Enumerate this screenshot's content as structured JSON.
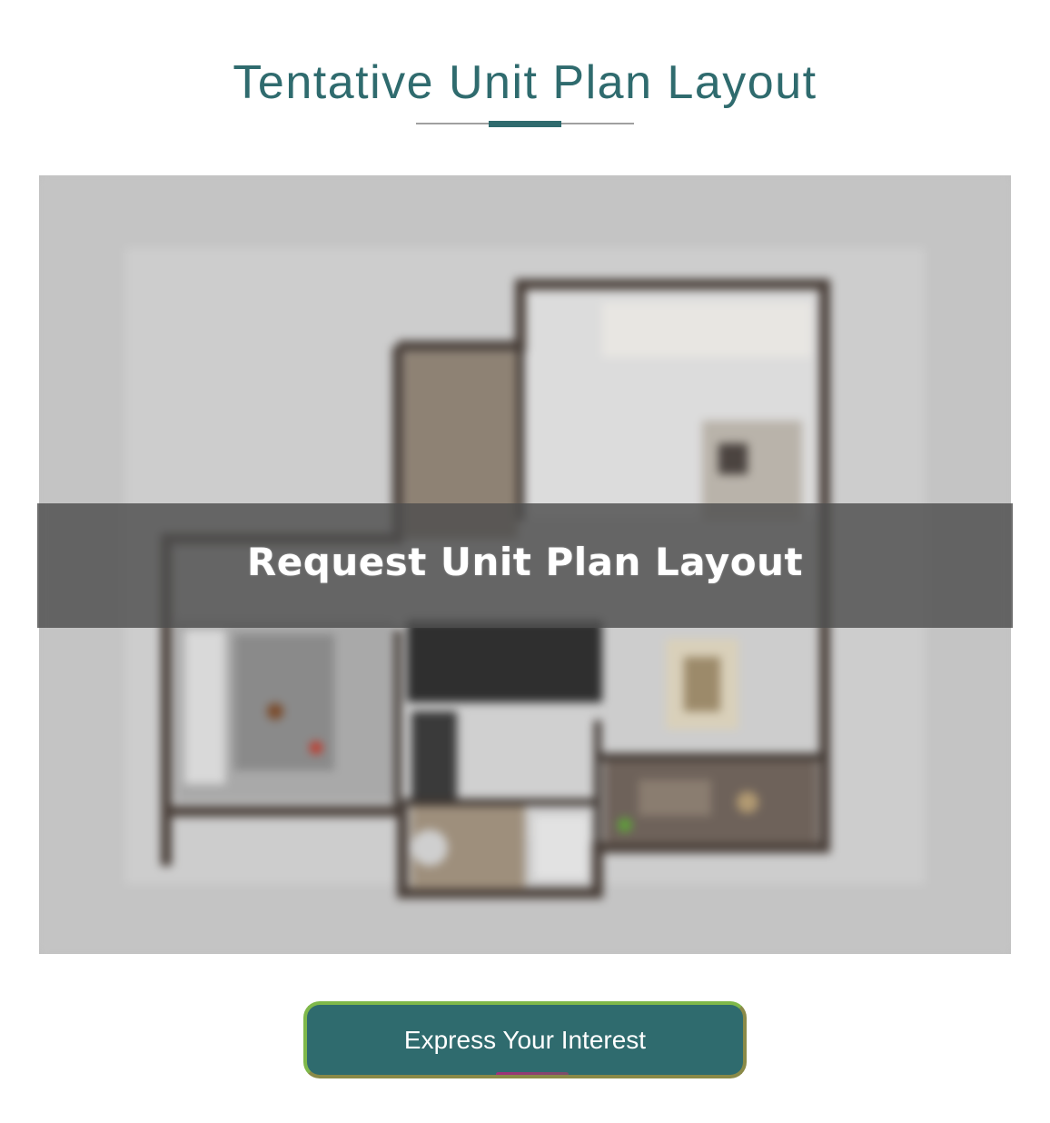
{
  "section": {
    "title": "Tentative Unit Plan Layout"
  },
  "plan": {
    "overlay_label": "Request Unit Plan Layout",
    "image_description_icon": "floor-plan-image"
  },
  "cta": {
    "label": "Express Your Interest"
  },
  "colors": {
    "accent": "#2f6b6e",
    "cta_border": "#7fb84a",
    "overlay": "#4e4e4e"
  }
}
